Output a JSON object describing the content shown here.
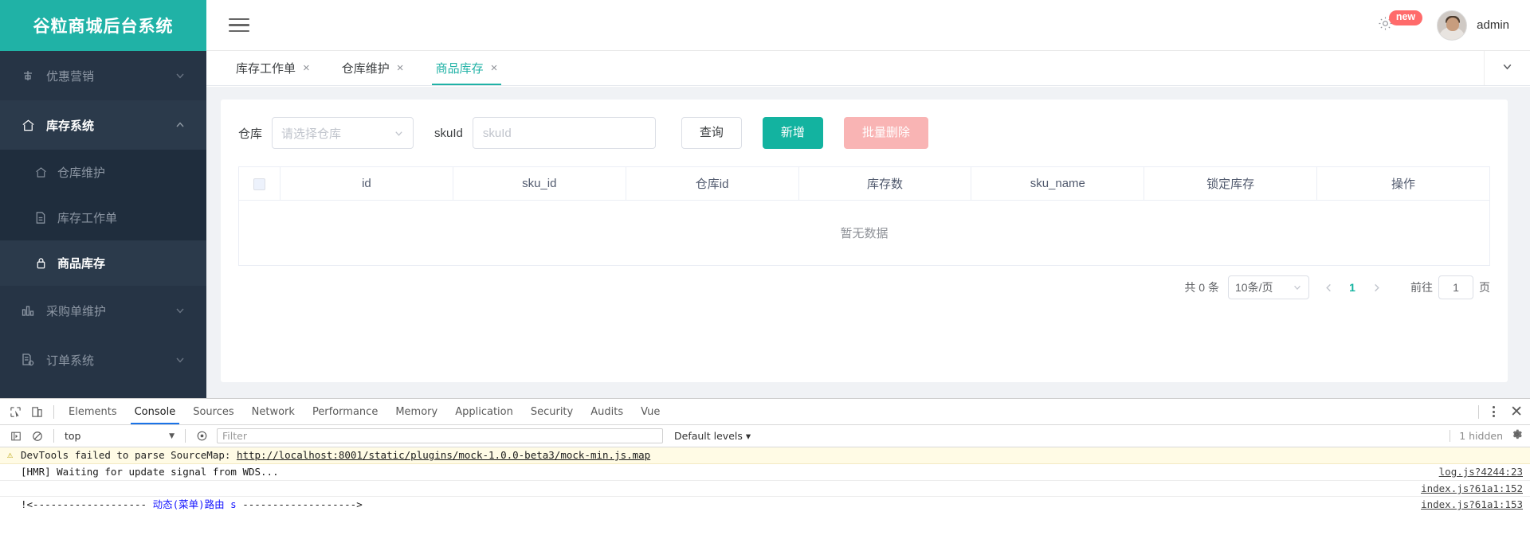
{
  "brand": {
    "title": "谷粒商城后台系统"
  },
  "sidebar": {
    "items": [
      {
        "label": "优惠营销",
        "icon": "coupon-icon",
        "arrow": "chevron-down",
        "level": 1,
        "state": "collapsed"
      },
      {
        "label": "库存系统",
        "icon": "home-icon",
        "arrow": "chevron-up",
        "level": 1,
        "state": "expanded"
      },
      {
        "label": "仓库维护",
        "icon": "home-icon",
        "arrow": "",
        "level": 2,
        "state": "normal"
      },
      {
        "label": "库存工作单",
        "icon": "document-icon",
        "arrow": "",
        "level": 2,
        "state": "normal"
      },
      {
        "label": "商品库存",
        "icon": "lock-icon",
        "arrow": "",
        "level": 2,
        "state": "selected"
      },
      {
        "label": "采购单维护",
        "icon": "chart-bar-icon",
        "arrow": "chevron-down",
        "level": 1,
        "state": "collapsed"
      },
      {
        "label": "订单系统",
        "icon": "order-icon",
        "arrow": "chevron-down",
        "level": 1,
        "state": "collapsed"
      }
    ]
  },
  "topbar": {
    "hamburger": "menu-icon",
    "gear": "gear-icon",
    "badge": "new",
    "username": "admin"
  },
  "tabs": [
    {
      "label": "库存工作单",
      "active": false
    },
    {
      "label": "仓库维护",
      "active": false
    },
    {
      "label": "商品库存",
      "active": true
    }
  ],
  "tabbar": {
    "collapse_icon": "chevron-down-icon"
  },
  "filter": {
    "warehouse_label": "仓库",
    "warehouse_placeholder": "请选择仓库",
    "warehouse_value": "",
    "skuid_label": "skuId",
    "skuid_placeholder": "skuId",
    "skuid_value": "",
    "search_button": "查询",
    "add_button": "新增",
    "batch_delete_button": "批量删除"
  },
  "table": {
    "columns": [
      "id",
      "sku_id",
      "仓库id",
      "库存数",
      "sku_name",
      "锁定库存",
      "操作"
    ],
    "rows": [],
    "empty_text": "暂无数据"
  },
  "pagination": {
    "total_text": "共 0 条",
    "page_size": "10条/页",
    "prev": "‹",
    "current_page": "1",
    "next": "›",
    "jump_prefix": "前往",
    "jump_value": "1",
    "jump_suffix": "页"
  },
  "devtools": {
    "tabs": [
      "Elements",
      "Console",
      "Sources",
      "Network",
      "Performance",
      "Memory",
      "Application",
      "Security",
      "Audits",
      "Vue"
    ],
    "active_tab": "Console",
    "inspect_icon": "inspect-element-icon",
    "device_icon": "device-toolbar-icon",
    "kebab": "more-options-icon",
    "close": "close-devtools-icon",
    "toolbar": {
      "execute_icon": "execute-context-icon",
      "clear_icon": "clear-console-icon",
      "context": "top",
      "eye_icon": "live-expression-icon",
      "filter_placeholder": "Filter",
      "filter_value": "",
      "levels": "Default levels ▾",
      "hidden": "1 hidden",
      "settings_icon": "console-settings-icon"
    },
    "messages": [
      {
        "type": "warning",
        "icon": "warning-triangle-icon",
        "text": "DevTools failed to parse SourceMap: ",
        "link": "http://localhost:8001/static/plugins/mock-1.0.0-beta3/mock-min.js.map",
        "source": ""
      },
      {
        "type": "log",
        "icon": "",
        "text": "[HMR] Waiting for update signal from WDS...",
        "link": "",
        "source": "log.js?4244:23"
      },
      {
        "type": "blank",
        "icon": "",
        "text": "",
        "link": "",
        "source": "index.js?61a1:152"
      },
      {
        "type": "route",
        "icon": "",
        "text_pre": "!<------------------- ",
        "text_mid": "动态(菜单)路由 s",
        "text_post": " ------------------->",
        "source": "index.js?61a1:153"
      }
    ]
  },
  "colors": {
    "brand_teal": "#20b2a6",
    "sidebar_bg": "#263445",
    "sidebar_sub_bg": "#1f2d3d",
    "primary_button": "#13b3a0",
    "danger_disabled": "#f9b4b4",
    "devtools_active": "#1a73e8",
    "warning_bg": "#fffbe5"
  }
}
